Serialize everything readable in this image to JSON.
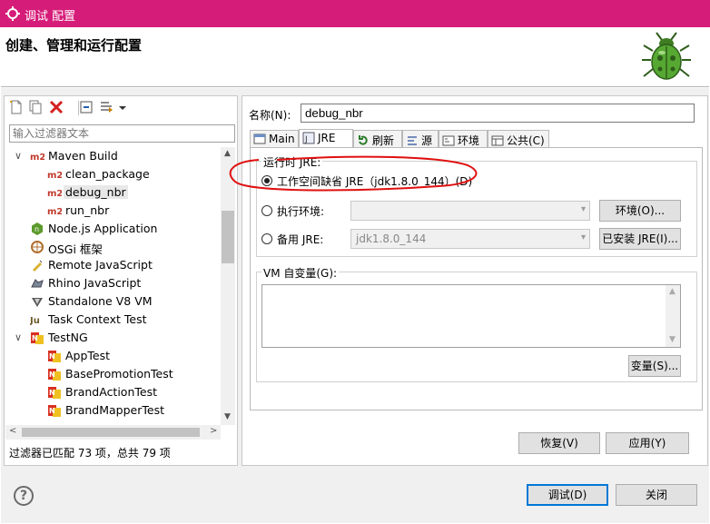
{
  "window": {
    "title": "调试 配置",
    "icon": "gear-icon"
  },
  "header": {
    "title": "创建、管理和运行配置",
    "logo": "bug-icon"
  },
  "left": {
    "toolbar": [
      {
        "name": "new-config-icon"
      },
      {
        "name": "duplicate-icon"
      },
      {
        "name": "delete-icon"
      },
      {
        "name": "collapse-all-icon"
      },
      {
        "name": "filter-icon"
      },
      {
        "name": "dropdown-arrow-icon"
      }
    ],
    "filter_placeholder": "输入过滤器文本",
    "tree": [
      {
        "label": "Maven Build",
        "icon": "maven-icon",
        "level": 1,
        "expanded": true,
        "badge": "m2"
      },
      {
        "label": "clean_package",
        "icon": "maven-icon",
        "level": 2,
        "badge": "m2"
      },
      {
        "label": "debug_nbr",
        "icon": "maven-icon",
        "level": 2,
        "badge": "m2",
        "selected": true
      },
      {
        "label": "run_nbr",
        "icon": "maven-icon",
        "level": 2,
        "badge": "m2"
      },
      {
        "label": "Node.js Application",
        "icon": "nodejs-icon",
        "level": 1
      },
      {
        "label": "OSGi 框架",
        "icon": "osgi-icon",
        "level": 1
      },
      {
        "label": "Remote JavaScript",
        "icon": "remote-js-icon",
        "level": 1
      },
      {
        "label": "Rhino JavaScript",
        "icon": "rhino-icon",
        "level": 1
      },
      {
        "label": "Standalone V8 VM",
        "icon": "v8-icon",
        "level": 1
      },
      {
        "label": "Task Context Test",
        "icon": "junit-icon",
        "level": 1,
        "badge": "Ju"
      },
      {
        "label": "TestNG",
        "icon": "testng-icon",
        "level": 1,
        "expanded": true
      },
      {
        "label": "AppTest",
        "icon": "testng-icon",
        "level": 2
      },
      {
        "label": "BasePromotionTest",
        "icon": "testng-icon",
        "level": 2
      },
      {
        "label": "BrandActionTest",
        "icon": "testng-icon",
        "level": 2
      },
      {
        "label": "BrandMapperTest",
        "icon": "testng-icon",
        "level": 2
      }
    ],
    "status": "过滤器已匹配 73 项，总共 79 项"
  },
  "right": {
    "name_label": "名称(N):",
    "name_value": "debug_nbr",
    "tabs": [
      {
        "label": "Main",
        "icon": "main-tab-icon"
      },
      {
        "label": "JRE",
        "icon": "jre-tab-icon",
        "active": true
      },
      {
        "label": "刷新",
        "icon": "refresh-tab-icon"
      },
      {
        "label": "源",
        "icon": "source-tab-icon"
      },
      {
        "label": "环境",
        "icon": "environment-tab-icon"
      },
      {
        "label": "公共(C)",
        "icon": "common-tab-icon"
      }
    ],
    "jre_group_label": "运行时 JRE:",
    "radio_workspace": "工作空间缺省 JRE（jdk1.8.0_144）(D)",
    "radio_exec_env": "执行环境:",
    "env_button": "环境(O)...",
    "radio_alt_jre": "备用 JRE:",
    "alt_jre_value": "jdk1.8.0_144",
    "installed_jre_button": "已安装 JRE(I)...",
    "vm_args_label": "VM 自变量(G):",
    "variables_button": "变量(S)...",
    "revert_button": "恢复(V)",
    "apply_button": "应用(Y)"
  },
  "footer": {
    "help": "?",
    "debug_button": "调试(D)",
    "close_button": "关闭"
  },
  "colors": {
    "titlebar": "#d61c79",
    "annotation": "#e01010"
  }
}
